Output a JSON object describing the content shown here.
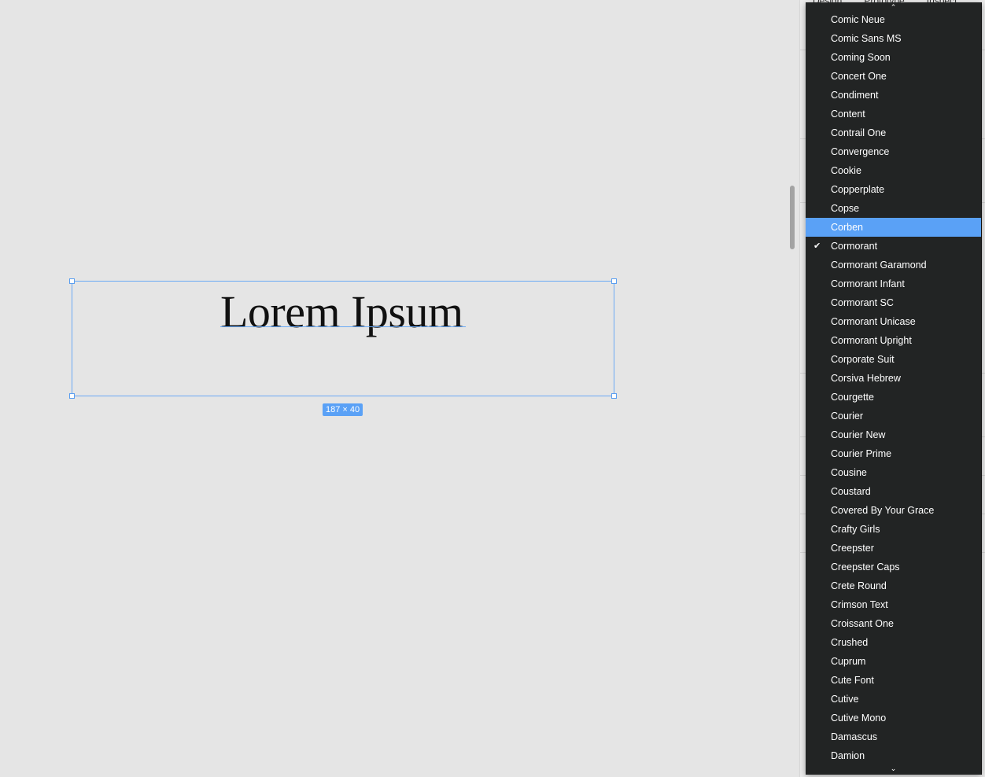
{
  "canvas": {
    "text_layer": "Lorem Ipsum",
    "size_badge": "187 × 40"
  },
  "right_panel": {
    "tabs": [
      "Design",
      "Prototype",
      "Inspect"
    ]
  },
  "font_dropdown": {
    "scroll_up_icon": "⌃",
    "scroll_down_icon": "⌄",
    "check_icon": "✔",
    "selected": "Cormorant",
    "highlighted": "Corben",
    "items": [
      "Comic Neue",
      "Comic Sans MS",
      "Coming Soon",
      "Concert One",
      "Condiment",
      "Content",
      "Contrail One",
      "Convergence",
      "Cookie",
      "Copperplate",
      "Copse",
      "Corben",
      "Cormorant",
      "Cormorant Garamond",
      "Cormorant Infant",
      "Cormorant SC",
      "Cormorant Unicase",
      "Cormorant Upright",
      "Corporate Suit",
      "Corsiva Hebrew",
      "Courgette",
      "Courier",
      "Courier New",
      "Courier Prime",
      "Cousine",
      "Coustard",
      "Covered By Your Grace",
      "Crafty Girls",
      "Creepster",
      "Creepster Caps",
      "Crete Round",
      "Crimson Text",
      "Croissant One",
      "Crushed",
      "Cuprum",
      "Cute Font",
      "Cutive",
      "Cutive Mono",
      "Damascus",
      "Damion"
    ]
  },
  "colors": {
    "accent": "#5aa1f6",
    "selection_border": "#6aa9f5",
    "dropdown_bg": "#222424",
    "canvas_bg": "#e5e5e5"
  }
}
